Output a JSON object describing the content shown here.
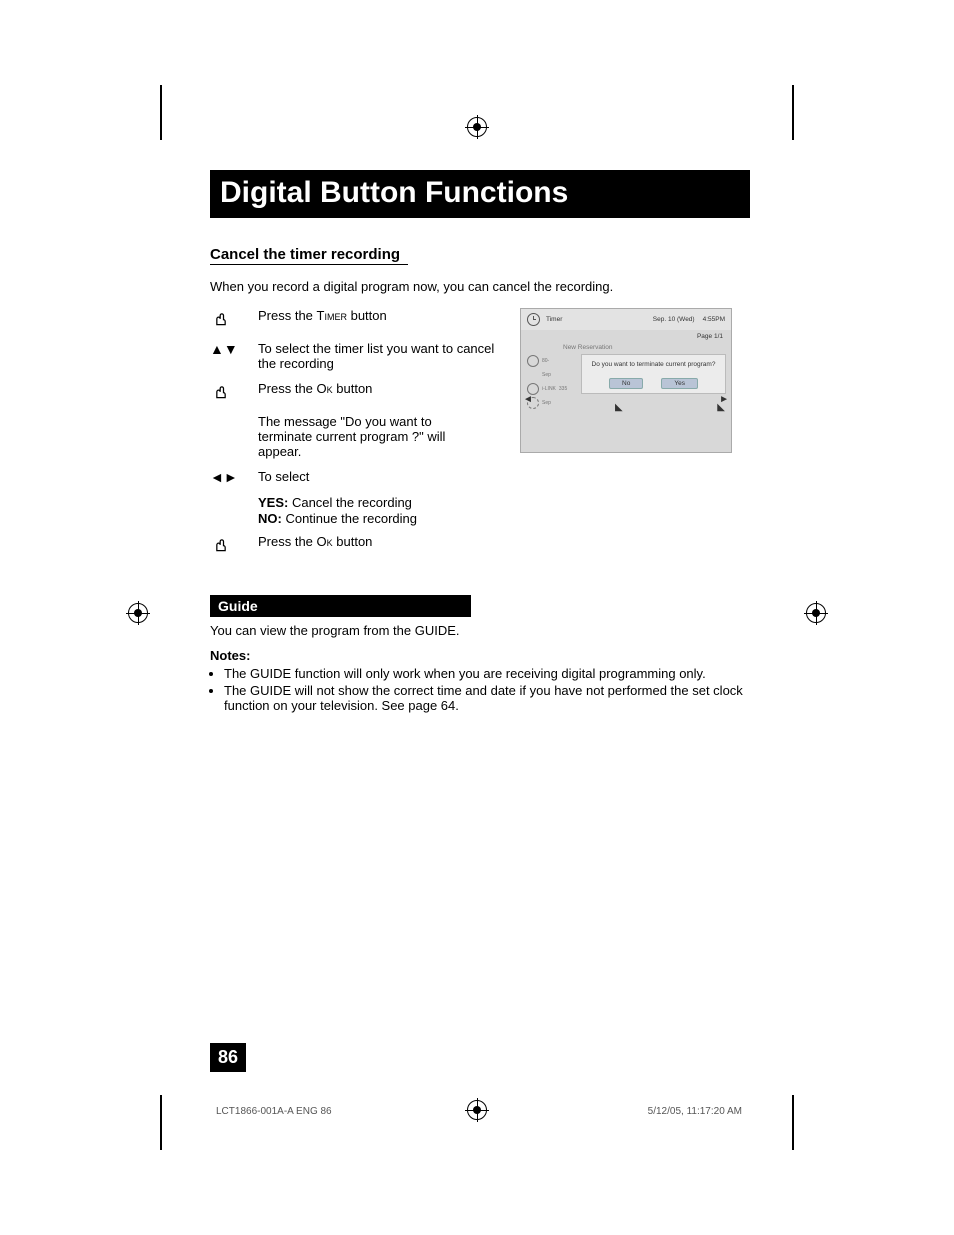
{
  "title": "Digital Button Functions",
  "section1": {
    "heading": "Cancel the timer recording",
    "intro": "When you record a digital program now, you can cancel the recording.",
    "steps": {
      "s1_pre": "Press the ",
      "s1_btn": "Timer",
      "s1_post": " button",
      "s2": "To select the timer list you want to cancel the recording",
      "s3_pre": "Press the ",
      "s3_btn": "Ok",
      "s3_post": " button",
      "s3_msg": "The message \"Do you want to terminate current program ?\" will appear.",
      "s4": "To select",
      "s4_yes_label": "YES:",
      "s4_yes_text": "  Cancel the recording",
      "s4_no_label": "NO:",
      "s4_no_text": "  Continue the recording",
      "s5_pre": "Press the ",
      "s5_btn": "Ok",
      "s5_post": " button"
    }
  },
  "screen": {
    "title": "Timer",
    "date": "Sep. 10 (Wed)",
    "time": "4:55PM",
    "page": "Page 1/1",
    "new_res": "New Reservation",
    "col_vals": {
      "a": "80-",
      "b": "Sep",
      "c": "i-LINK",
      "d": "335",
      "e": "Sep"
    },
    "dialog_q": "Do you want to terminate current program?",
    "no": "No",
    "yes": "Yes"
  },
  "section2": {
    "heading": "Guide",
    "intro": "You can view the program from the GUIDE.",
    "notes_label": "Notes:",
    "notes": [
      "The GUIDE function will only work when you are receiving digital programming only.",
      "The GUIDE will not show the correct time and date if you have not performed the set clock function on your television.  See page 64."
    ]
  },
  "page_number": "86",
  "footer_left": "LCT1866-001A-A ENG   86",
  "footer_right": "5/12/05, 11:17:20 AM"
}
